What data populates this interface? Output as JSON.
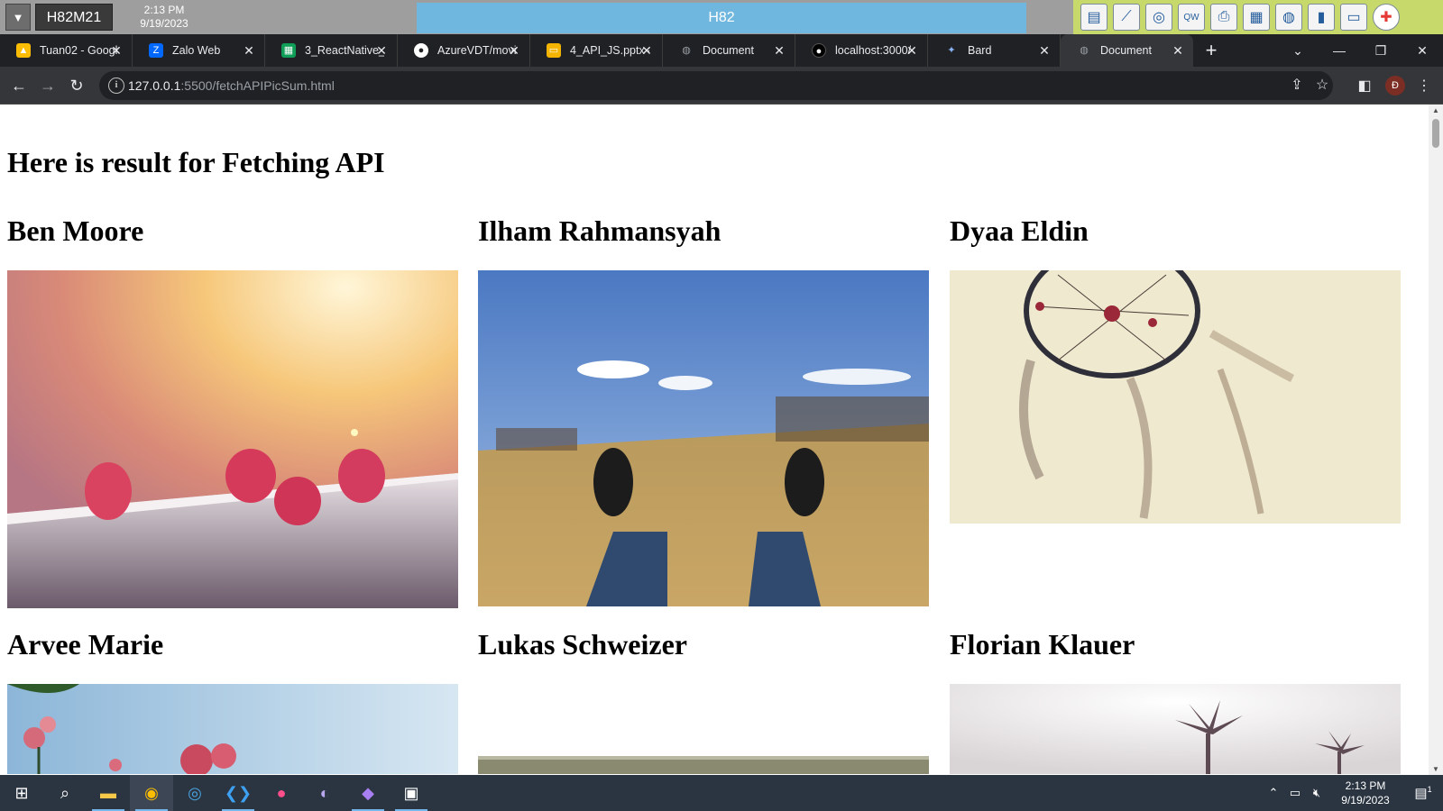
{
  "remote_bar": {
    "host_label": "H82M21",
    "time": "2:13 PM",
    "date": "9/19/2023",
    "session_title": "H82",
    "tools": [
      "file-cabinet-icon",
      "chart-icon",
      "disc-icon",
      "keyboard-icon",
      "printer-icon",
      "window-icon",
      "globe-icon",
      "book-icon",
      "chat-icon",
      "lifebuoy-icon"
    ]
  },
  "tabs": [
    {
      "title": "Tuan02 - Googl",
      "icon": "google-drive-icon",
      "color": "#fbbc04"
    },
    {
      "title": "Zalo Web",
      "icon": "zalo-icon",
      "color": "#0068ff"
    },
    {
      "title": "3_ReactNative_T",
      "icon": "google-sheets-icon",
      "color": "#0f9d58"
    },
    {
      "title": "AzureVDT/movi",
      "icon": "github-icon",
      "color": "#ffffff"
    },
    {
      "title": "4_API_JS.pptx -",
      "icon": "google-slides-icon",
      "color": "#f4b400"
    },
    {
      "title": "Document",
      "icon": "globe-icon",
      "color": "#9aa0a6"
    },
    {
      "title": "localhost:3000/",
      "icon": "github-icon",
      "color": "#000000"
    },
    {
      "title": "Bard",
      "icon": "bard-icon",
      "color": "#4285f4"
    },
    {
      "title": "Document",
      "icon": "globe-icon",
      "color": "#9aa0a6",
      "active": true
    }
  ],
  "address": {
    "host": "127.0.0.1",
    "rest": ":5500/fetchAPIPicSum.html"
  },
  "page": {
    "heading": "Here is result for Fetching API",
    "cards": [
      {
        "author": "Ben Moore",
        "image": "raspberries"
      },
      {
        "author": "Ilham Rahmansyah",
        "image": "sneakers-on-grass"
      },
      {
        "author": "Dyaa Eldin",
        "image": "dreamcatcher"
      },
      {
        "author": "Arvee Marie",
        "image": "flowers-sky"
      },
      {
        "author": "Lukas Schweizer",
        "image": "loading-photo"
      },
      {
        "author": "Florian Klauer",
        "image": "palm-trees"
      }
    ]
  },
  "taskbar": {
    "apps": [
      "windows-start-icon",
      "search-icon",
      "file-explorer-icon",
      "chrome-icon",
      "browser-icon",
      "vscode-icon",
      "app-icon",
      "eclipse-icon",
      "visual-studio-icon",
      "terminal-icon"
    ],
    "time": "2:13 PM",
    "date": "9/19/2023",
    "notifications": "1"
  }
}
